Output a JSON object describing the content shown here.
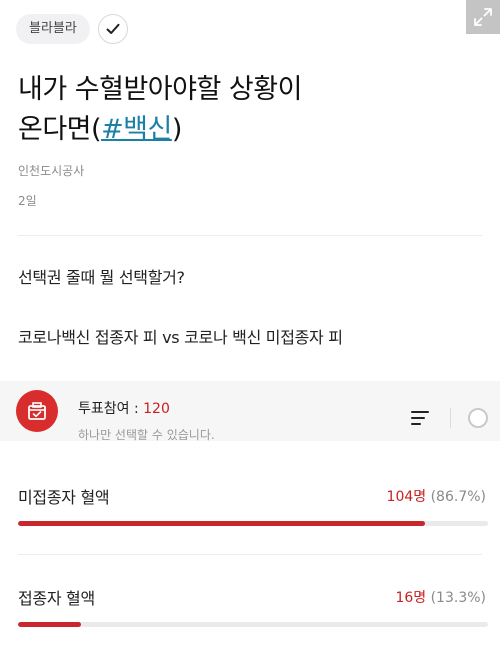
{
  "category_chip": "블라블라",
  "post": {
    "title_line1": "내가 수혈받아야할 상황이",
    "title_line2_prefix": "온다면(",
    "title_tag": "#백신",
    "title_line2_suffix": ")",
    "author": "인천도시공사",
    "date": "2일",
    "body_line1": "선택권 줄때 뭘 선택할거?",
    "body_line2": "코로나백신 접종자 피 vs 코로나 백신 미접종자 피"
  },
  "poll": {
    "participants_label": "투표참여 : ",
    "participants_count": "120",
    "hint": "하나만 선택할 수 있습니다.",
    "options": [
      {
        "label": "미접종자 혈액",
        "count": "104명",
        "percent_text": "(86.7%)",
        "ratio": 0.867
      },
      {
        "label": "접종자 혈액",
        "count": "16명",
        "percent_text": "(13.3%)",
        "ratio": 0.133
      }
    ]
  },
  "colors": {
    "accent": "#d92c2c",
    "tag": "#1c7fa6"
  },
  "icons": {
    "check": "check-icon",
    "expand": "expand-icon",
    "ballot": "ballot-box-icon",
    "sort": "sort-icon"
  }
}
